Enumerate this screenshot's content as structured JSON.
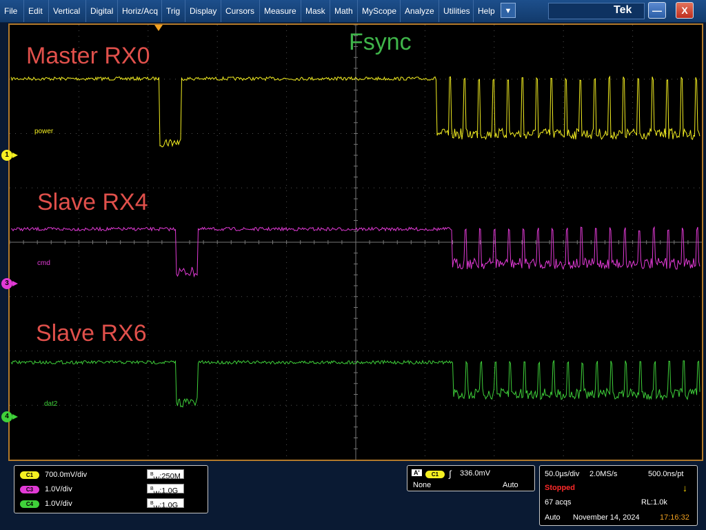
{
  "menu": [
    "File",
    "Edit",
    "Vertical",
    "Digital",
    "Horiz/Acq",
    "Trig",
    "Display",
    "Cursors",
    "Measure",
    "Mask",
    "Math",
    "MyScope",
    "Analyze",
    "Utilities",
    "Help"
  ],
  "titlebar": {
    "brand": "Tek",
    "minimize": "—",
    "close": "X"
  },
  "screen": {
    "labels": {
      "master": "Master RX0",
      "fsync": "Fsync",
      "slave4": "Slave RX4",
      "slave6": "Slave RX6"
    },
    "channels": [
      {
        "num": "1",
        "name": "power",
        "color": "#f5f021"
      },
      {
        "num": "3",
        "name": "cmd",
        "color": "#e23ad6"
      },
      {
        "num": "4",
        "name": "dat2",
        "color": "#3fd13a"
      }
    ],
    "label_colors": {
      "trace": "#e0504b",
      "fsync": "#3fb54a"
    }
  },
  "vertical_panel": {
    "rows": [
      {
        "ch": "C1",
        "scale": "700.0mV/div",
        "bw": "250M",
        "color": "#f5f021"
      },
      {
        "ch": "C3",
        "scale": "1.0V/div",
        "bw": "1.0G",
        "color": "#e23ad6"
      },
      {
        "ch": "C4",
        "scale": "1.0V/div",
        "bw": "1.0G",
        "color": "#3fd13a"
      }
    ]
  },
  "trigger_panel": {
    "a": "A'",
    "ch": "C1",
    "level": "336.0mV",
    "coupling": "None",
    "mode": "Auto"
  },
  "acq_panel": {
    "timebase": "50.0µs/div",
    "samplerate": "2.0MS/s",
    "resolution": "500.0ns/pt",
    "state": "Stopped",
    "acqs": "67 acqs",
    "rl": "RL:1.0k",
    "mode": "Auto",
    "date": "November 14, 2024",
    "time": "17:16:32"
  }
}
